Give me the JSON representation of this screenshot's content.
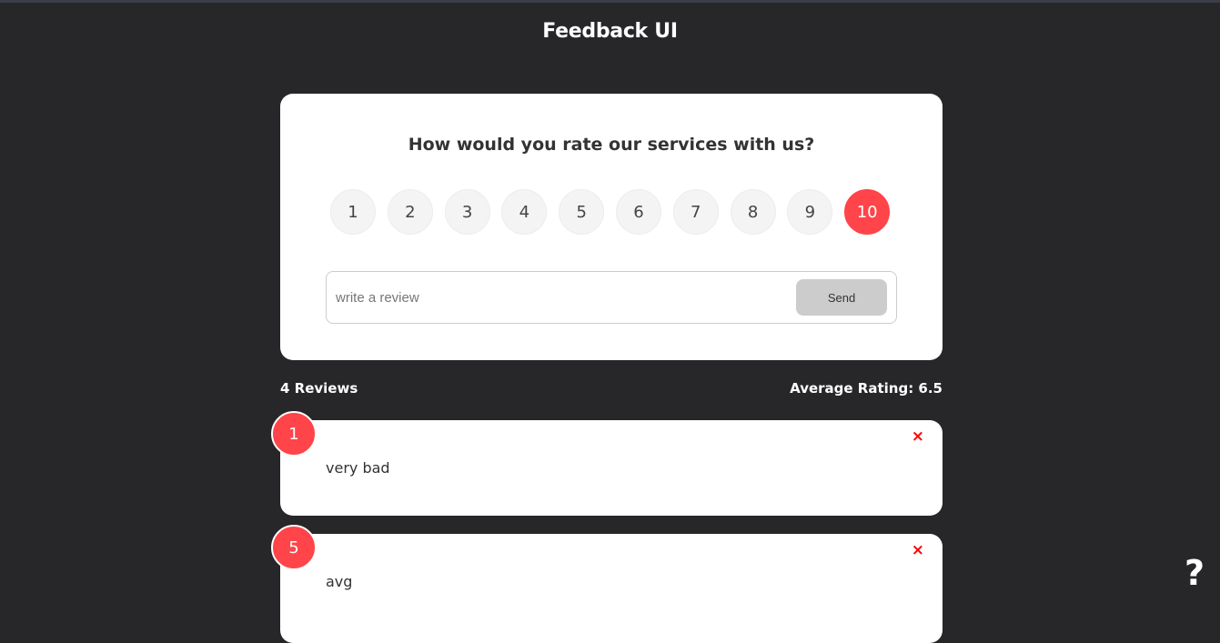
{
  "app": {
    "title": "Feedback UI"
  },
  "rating_form": {
    "question": "How would you rate our services with us?",
    "options": [
      "1",
      "2",
      "3",
      "4",
      "5",
      "6",
      "7",
      "8",
      "9",
      "10"
    ],
    "selected": "10",
    "review_placeholder": "write a review",
    "review_value": "",
    "send_label": "Send"
  },
  "stats": {
    "count_label": "4 Reviews",
    "average_label": "Average Rating: 6.5"
  },
  "reviews": [
    {
      "rating": "1",
      "text": "very bad",
      "delete_icon": "×"
    },
    {
      "rating": "5",
      "text": "avg",
      "delete_icon": "×"
    }
  ],
  "help": {
    "icon": "?"
  },
  "colors": {
    "background": "#27272a",
    "accent": "#ff444a",
    "card": "#ffffff",
    "delete": "#ff0000"
  }
}
